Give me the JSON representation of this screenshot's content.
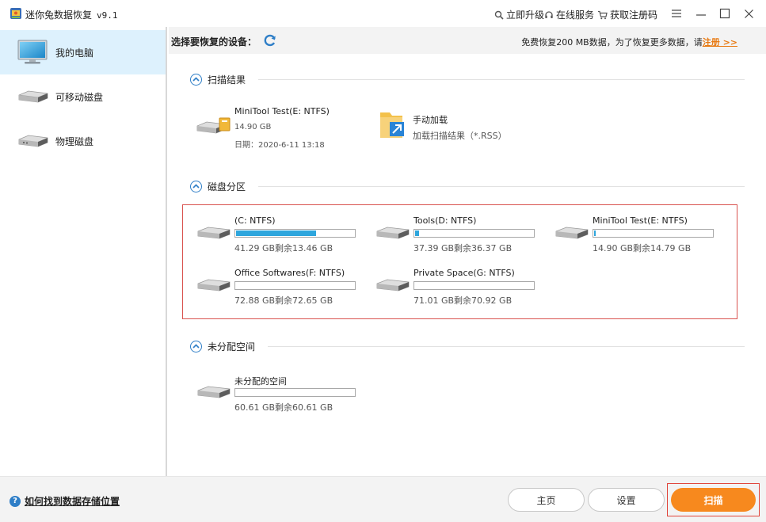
{
  "app": {
    "title": "迷你兔数据恢复",
    "version": "v9.1"
  },
  "titlebar": {
    "upgrade": "立即升级",
    "service": "在线服务",
    "register": "获取注册码"
  },
  "sidebar": {
    "items": [
      {
        "label": "我的电脑",
        "icon": "computer-icon",
        "active": true
      },
      {
        "label": "可移动磁盘",
        "icon": "drive-icon",
        "active": false
      },
      {
        "label": "物理磁盘",
        "icon": "drive-icon",
        "active": false
      }
    ]
  },
  "header": {
    "title": "选择要恢复的设备：",
    "notice": "免费恢复200 MB数据，为了恢复更多数据，请",
    "register_link": "注册 >>"
  },
  "sections": {
    "scan_results": {
      "title": "扫描结果",
      "result": {
        "name": "MiniTool Test(E: NTFS)",
        "size": "14.90 GB",
        "date": "日期：2020-6-11 13:18"
      },
      "manual": {
        "name": "手动加载",
        "desc": "加载扫描结果（*.RSS）"
      }
    },
    "partitions": {
      "title": "磁盘分区",
      "items": [
        {
          "name": "(C: NTFS)",
          "usage": "41.29 GB剩余13.46 GB",
          "used_pct": 67
        },
        {
          "name": "Tools(D: NTFS)",
          "usage": "37.39 GB剩余36.37 GB",
          "used_pct": 3
        },
        {
          "name": "MiniTool Test(E: NTFS)",
          "usage": "14.90 GB剩余14.79 GB",
          "used_pct": 1
        },
        {
          "name": "Office Softwares(F: NTFS)",
          "usage": "72.88 GB剩余72.65 GB",
          "used_pct": 0
        },
        {
          "name": "Private Space(G: NTFS)",
          "usage": "71.01 GB剩余70.92 GB",
          "used_pct": 0
        }
      ]
    },
    "unallocated": {
      "title": "未分配空间",
      "items": [
        {
          "name": "未分配的空间",
          "usage": "60.61 GB剩余60.61 GB",
          "used_pct": 0
        }
      ]
    }
  },
  "footer": {
    "help": "如何找到数据存储位置",
    "home": "主页",
    "settings": "设置",
    "scan": "扫描"
  },
  "colors": {
    "accent": "#2ea6dd",
    "scan": "#f7891e",
    "link": "#e87a12",
    "highlight": "#d9534f"
  }
}
